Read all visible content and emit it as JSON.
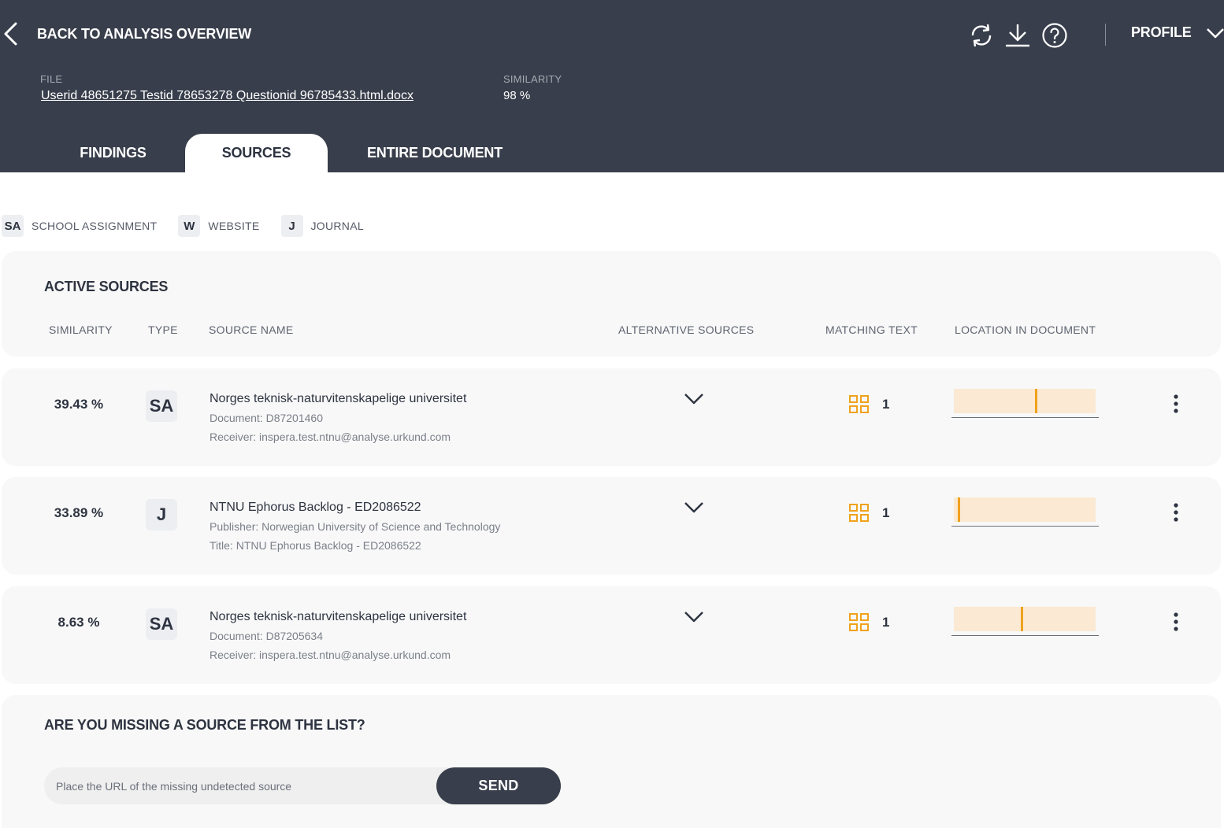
{
  "header": {
    "back_label": "BACK TO ANALYSIS OVERVIEW",
    "profile_label": "PROFILE",
    "icons": [
      "refresh-icon",
      "download-icon",
      "help-icon",
      "chevron-down-icon"
    ],
    "file_label": "FILE",
    "file_name": "Userid 48651275 Testid 78653278 Questionid 96785433.html.docx",
    "similarity_label": "SIMILARITY",
    "similarity_value": "98 %"
  },
  "tabs": [
    {
      "label": "FINDINGS",
      "active": false
    },
    {
      "label": "SOURCES",
      "active": true
    },
    {
      "label": "ENTIRE DOCUMENT",
      "active": false
    }
  ],
  "legend": [
    {
      "code": "SA",
      "label": "SCHOOL ASSIGNMENT"
    },
    {
      "code": "W",
      "label": "WEBSITE"
    },
    {
      "code": "J",
      "label": "JOURNAL"
    }
  ],
  "active_sources": {
    "title": "ACTIVE SOURCES",
    "columns": {
      "similarity": "SIMILARITY",
      "type": "TYPE",
      "source_name": "SOURCE NAME",
      "alternative": "ALTERNATIVE SOURCES",
      "matching": "MATCHING TEXT",
      "location": "LOCATION IN DOCUMENT"
    },
    "rows": [
      {
        "similarity": "39.43 %",
        "type": "SA",
        "name": "Norges teknisk-naturvitenskapelige universitet",
        "line1": "Document: D87201460",
        "line2": "Receiver: inspera.test.ntnu@analyse.urkund.com",
        "matching_count": "1",
        "location_fraction": 0.58
      },
      {
        "similarity": "33.89 %",
        "type": "J",
        "name": "NTNU Ephorus Backlog - ED2086522",
        "line1": "Publisher: Norwegian University of Science and Technology",
        "line2": "Title: NTNU Ephorus Backlog - ED2086522",
        "matching_count": "1",
        "location_fraction": 0.03
      },
      {
        "similarity": "8.63 %",
        "type": "SA",
        "name": "Norges teknisk-naturvitenskapelige universitet",
        "line1": "Document: D87205634",
        "line2": "Receiver: inspera.test.ntnu@analyse.urkund.com",
        "matching_count": "1",
        "location_fraction": 0.48
      }
    ]
  },
  "missing": {
    "title": "ARE YOU MISSING A SOURCE FROM THE LIST?",
    "placeholder": "Place the URL of the missing undetected source",
    "send_label": "SEND"
  },
  "colors": {
    "header_bg": "#383e4b",
    "accent_orange": "#f0a21d",
    "location_fill": "#fbe9d3",
    "card_bg": "#f8f8f8"
  }
}
